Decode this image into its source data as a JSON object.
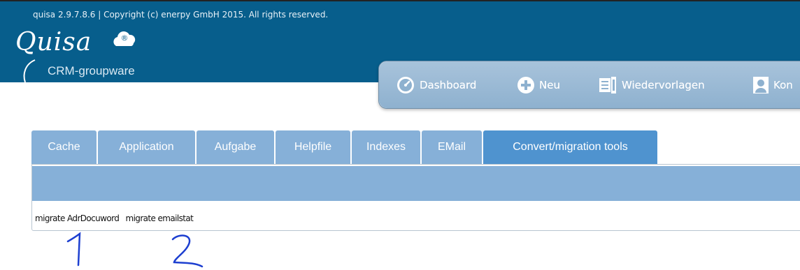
{
  "header": {
    "copyright": "quisa 2.9.7.8.6 | Copyright (c) enerpy GmbH 2015. All rights reserved.",
    "logo_word": "Quisa",
    "logo_subtitle": "CRM-groupware",
    "logo_mark": "®"
  },
  "nav": {
    "items": [
      {
        "label": "Dashboard",
        "icon": "dashboard-gauge-icon"
      },
      {
        "label": "Neu",
        "icon": "plus-circle-icon"
      },
      {
        "label": "Wiedervorlagen",
        "icon": "resubmission-documents-icon"
      },
      {
        "label": "Kon",
        "icon": "contact-person-icon"
      }
    ]
  },
  "tabs": [
    {
      "label": "Cache",
      "active": false
    },
    {
      "label": "Application",
      "active": false
    },
    {
      "label": "Aufgabe",
      "active": false
    },
    {
      "label": "Helpfile",
      "active": false
    },
    {
      "label": "Indexes",
      "active": false
    },
    {
      "label": "EMail",
      "active": false
    },
    {
      "label": "Convert/migration tools",
      "active": true
    }
  ],
  "tools": {
    "links": [
      "migrate AdrDocuword",
      "migrate emailstat"
    ]
  },
  "colors": {
    "header_bg": "#075e8c",
    "tab_bg": "#86b0d8",
    "tab_active_bg": "#4f93cf",
    "annotation_ink": "#1d3fd0"
  }
}
